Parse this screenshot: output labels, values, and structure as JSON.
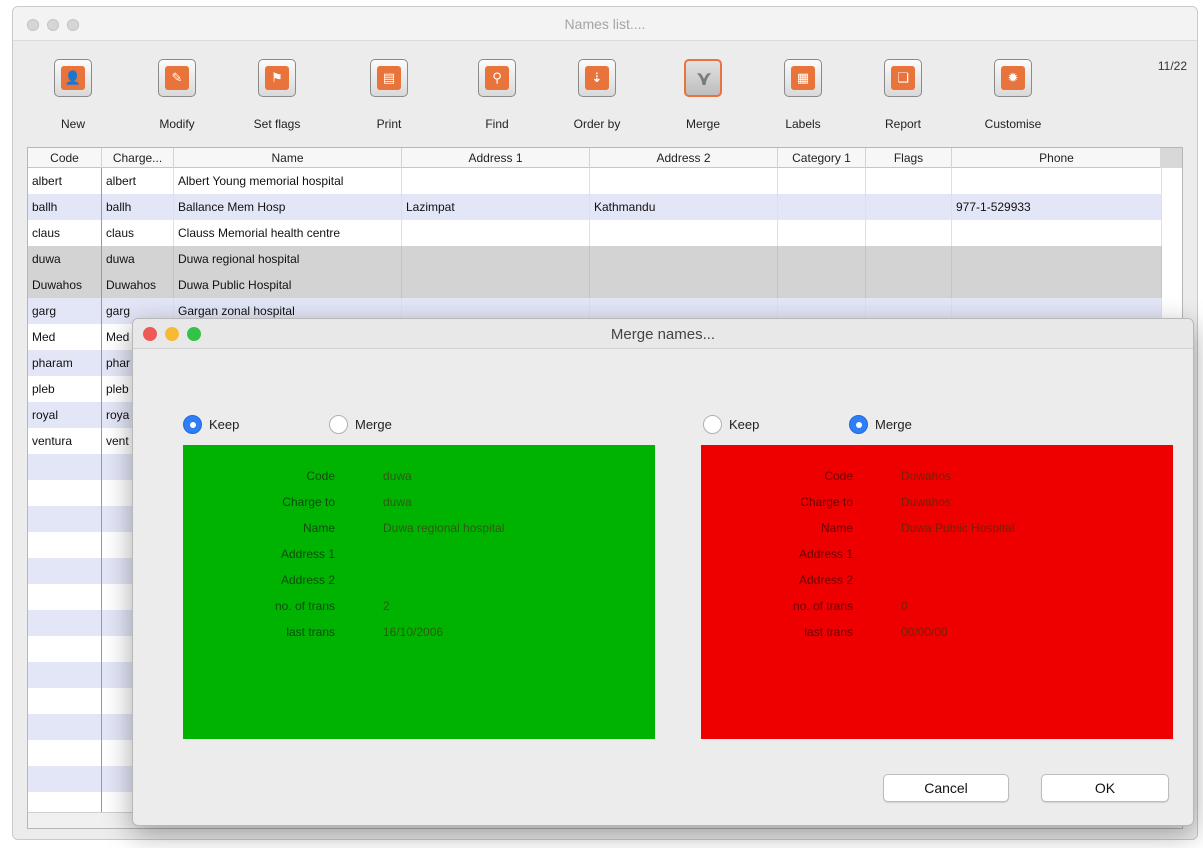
{
  "window": {
    "title": "Names list...."
  },
  "toolbar": {
    "buttons": [
      {
        "label": "New",
        "icon": "person-icon",
        "glyph": "👤"
      },
      {
        "label": "Modify",
        "icon": "edit-icon",
        "glyph": "✎"
      },
      {
        "label": "Set flags",
        "icon": "flag-icon",
        "glyph": "⚑"
      },
      {
        "label": "Print",
        "icon": "printer-icon",
        "glyph": "▤"
      },
      {
        "label": "Find",
        "icon": "magnifier-icon",
        "glyph": "⚲"
      },
      {
        "label": "Order by",
        "icon": "sort-icon",
        "glyph": "⇣"
      },
      {
        "label": "Merge",
        "icon": "merge-icon",
        "glyph": "⋎"
      },
      {
        "label": "Labels",
        "icon": "labels-icon",
        "glyph": "▦"
      },
      {
        "label": "Report",
        "icon": "report-icon",
        "glyph": "❏"
      },
      {
        "label": "Customise",
        "icon": "gear-icon",
        "glyph": "✹"
      }
    ],
    "counter": "11/22"
  },
  "table": {
    "columns": [
      "Code",
      "Charge...",
      "Name",
      "Address 1",
      "Address 2",
      "Category 1",
      "Flags",
      "Phone"
    ],
    "rows": [
      {
        "cells": [
          "albert",
          "albert",
          "Albert Young memorial hospital",
          "",
          "",
          "",
          "",
          ""
        ],
        "style": "white"
      },
      {
        "cells": [
          "ballh",
          "ballh",
          "Ballance Mem Hosp",
          "Lazimpat",
          "Kathmandu",
          "",
          "",
          "977-1-529933"
        ],
        "style": "blue"
      },
      {
        "cells": [
          "claus",
          "claus",
          "Clauss Memorial health centre",
          "",
          "",
          "",
          "",
          ""
        ],
        "style": "white"
      },
      {
        "cells": [
          "duwa",
          "duwa",
          "Duwa regional hospital",
          "",
          "",
          "",
          "",
          ""
        ],
        "style": "grey"
      },
      {
        "cells": [
          "Duwahos",
          "Duwahos",
          "Duwa Public Hospital",
          "",
          "",
          "",
          "",
          ""
        ],
        "style": "grey"
      },
      {
        "cells": [
          "garg",
          "garg",
          "Gargan zonal hospital",
          "",
          "",
          "",
          "",
          ""
        ],
        "style": "blue"
      },
      {
        "cells": [
          "Med",
          "Med",
          "",
          "",
          "",
          "",
          "",
          ""
        ],
        "style": "white"
      },
      {
        "cells": [
          "pharam",
          "phar",
          "",
          "",
          "",
          "",
          "",
          ""
        ],
        "style": "blue"
      },
      {
        "cells": [
          "pleb",
          "pleb",
          "",
          "",
          "",
          "",
          "",
          ""
        ],
        "style": "white"
      },
      {
        "cells": [
          "royal",
          "roya",
          "",
          "",
          "",
          "",
          "",
          ""
        ],
        "style": "blue"
      },
      {
        "cells": [
          "ventura",
          "vent",
          "",
          "",
          "",
          "",
          "",
          ""
        ],
        "style": "white"
      }
    ]
  },
  "dialog": {
    "title": "Merge names...",
    "left": {
      "keep_label": "Keep",
      "merge_label": "Merge",
      "selected": "keep",
      "color": "#00b300",
      "fields": [
        {
          "label": "Code",
          "value": "duwa"
        },
        {
          "label": "Charge to",
          "value": "duwa"
        },
        {
          "label": "Name",
          "value": "Duwa regional hospital"
        },
        {
          "label": "Address 1",
          "value": ""
        },
        {
          "label": "Address 2",
          "value": ""
        },
        {
          "label": "no. of trans",
          "value": "2"
        },
        {
          "label": "last trans",
          "value": "16/10/2006"
        }
      ]
    },
    "right": {
      "keep_label": "Keep",
      "merge_label": "Merge",
      "selected": "merge",
      "color": "#ee0000",
      "fields": [
        {
          "label": "Code",
          "value": "Duwahos"
        },
        {
          "label": "Charge to",
          "value": "Duwahos"
        },
        {
          "label": "Name",
          "value": "Duwa Public Hospital"
        },
        {
          "label": "Address 1",
          "value": ""
        },
        {
          "label": "Address 2",
          "value": ""
        },
        {
          "label": "no. of trans",
          "value": "0"
        },
        {
          "label": "last trans",
          "value": "00/00/00"
        }
      ]
    },
    "cancel_label": "Cancel",
    "ok_label": "OK"
  },
  "colors": {
    "accent": "#e8743c",
    "radio_on": "#2f7ef5",
    "row_blue": "#e3e6f7",
    "row_grey": "#d3d3d3"
  }
}
